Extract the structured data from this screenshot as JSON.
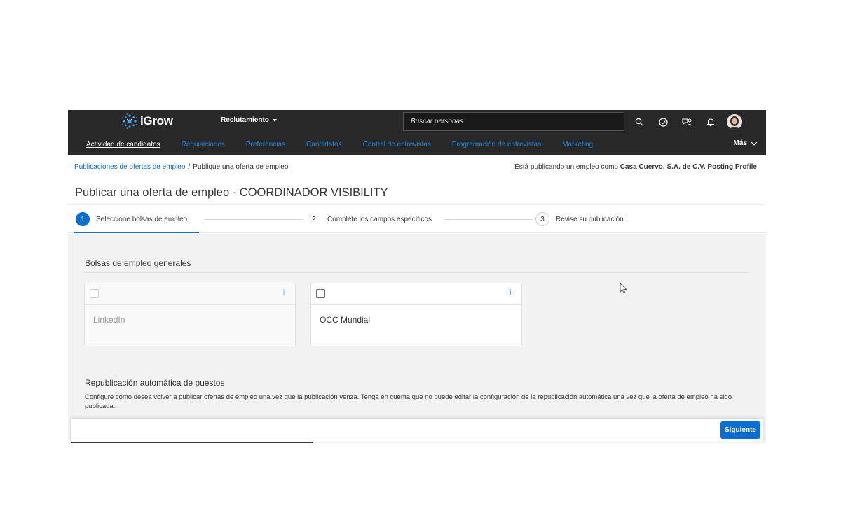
{
  "app": {
    "logo_text": "iGrow",
    "module": "Reclutamiento",
    "search": {
      "placeholder": "Buscar personas"
    }
  },
  "icons": [
    "search-icon",
    "check-circle-icon",
    "chat-icon",
    "bell-icon",
    "avatar"
  ],
  "nav": {
    "items": [
      {
        "label": "Actividad de candidatos",
        "active": true
      },
      {
        "label": "Requisiciones"
      },
      {
        "label": "Preferencias"
      },
      {
        "label": "Candidatos"
      },
      {
        "label": "Central de entrevistas"
      },
      {
        "label": "Programación de entrevistas"
      },
      {
        "label": "Marketing"
      }
    ],
    "more_label": "Más"
  },
  "breadcrumb": {
    "link": "Publicaciones de ofertas de empleo",
    "separator": "/",
    "current": "Publique una oferta de empleo"
  },
  "posting": {
    "prefix": "Está publicando un empleo como",
    "profile": "Casa Cuervo, S.A. de C.V. Posting Profile"
  },
  "page_title": "Publicar una oferta de empleo - COORDINADOR VISIBILITY",
  "steps": [
    {
      "num": "1",
      "label": "Seleccione bolsas de empleo",
      "active": true
    },
    {
      "num": "2",
      "label": "Complete los campos específicos"
    },
    {
      "num": "3",
      "label": "Revise su publicación"
    }
  ],
  "general_boards": {
    "title": "Bolsas de empleo generales",
    "cards": [
      {
        "name": "LinkedIn",
        "disabled": true,
        "info": "i"
      },
      {
        "name": "OCC Mundial",
        "disabled": false,
        "info": "i"
      }
    ]
  },
  "republish": {
    "title": "Republicación automática de puestos",
    "description": "Configure cómo desea volver a publicar ofertas de empleo una vez que la publicación venza. Tenga en cuenta que no puede editar la configuración de la republicación automática una vez que la oferta de empleo ha sido publicada."
  },
  "footer": {
    "next_label": "Siguiente"
  },
  "colors": {
    "brand_blue": "#0a6ed1",
    "topbar": "#282828",
    "link_blue": "#1a8cf0"
  }
}
